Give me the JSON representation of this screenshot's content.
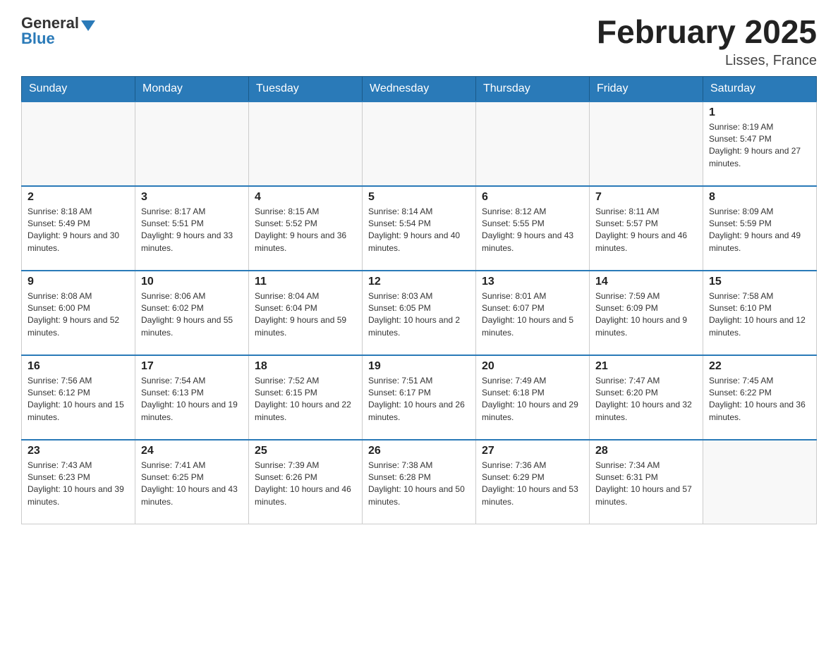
{
  "logo": {
    "general": "General",
    "blue": "Blue",
    "triangle": "▶"
  },
  "title": "February 2025",
  "location": "Lisses, France",
  "weekdays": [
    "Sunday",
    "Monday",
    "Tuesday",
    "Wednesday",
    "Thursday",
    "Friday",
    "Saturday"
  ],
  "weeks": [
    [
      {
        "day": "",
        "info": ""
      },
      {
        "day": "",
        "info": ""
      },
      {
        "day": "",
        "info": ""
      },
      {
        "day": "",
        "info": ""
      },
      {
        "day": "",
        "info": ""
      },
      {
        "day": "",
        "info": ""
      },
      {
        "day": "1",
        "info": "Sunrise: 8:19 AM\nSunset: 5:47 PM\nDaylight: 9 hours and 27 minutes."
      }
    ],
    [
      {
        "day": "2",
        "info": "Sunrise: 8:18 AM\nSunset: 5:49 PM\nDaylight: 9 hours and 30 minutes."
      },
      {
        "day": "3",
        "info": "Sunrise: 8:17 AM\nSunset: 5:51 PM\nDaylight: 9 hours and 33 minutes."
      },
      {
        "day": "4",
        "info": "Sunrise: 8:15 AM\nSunset: 5:52 PM\nDaylight: 9 hours and 36 minutes."
      },
      {
        "day": "5",
        "info": "Sunrise: 8:14 AM\nSunset: 5:54 PM\nDaylight: 9 hours and 40 minutes."
      },
      {
        "day": "6",
        "info": "Sunrise: 8:12 AM\nSunset: 5:55 PM\nDaylight: 9 hours and 43 minutes."
      },
      {
        "day": "7",
        "info": "Sunrise: 8:11 AM\nSunset: 5:57 PM\nDaylight: 9 hours and 46 minutes."
      },
      {
        "day": "8",
        "info": "Sunrise: 8:09 AM\nSunset: 5:59 PM\nDaylight: 9 hours and 49 minutes."
      }
    ],
    [
      {
        "day": "9",
        "info": "Sunrise: 8:08 AM\nSunset: 6:00 PM\nDaylight: 9 hours and 52 minutes."
      },
      {
        "day": "10",
        "info": "Sunrise: 8:06 AM\nSunset: 6:02 PM\nDaylight: 9 hours and 55 minutes."
      },
      {
        "day": "11",
        "info": "Sunrise: 8:04 AM\nSunset: 6:04 PM\nDaylight: 9 hours and 59 minutes."
      },
      {
        "day": "12",
        "info": "Sunrise: 8:03 AM\nSunset: 6:05 PM\nDaylight: 10 hours and 2 minutes."
      },
      {
        "day": "13",
        "info": "Sunrise: 8:01 AM\nSunset: 6:07 PM\nDaylight: 10 hours and 5 minutes."
      },
      {
        "day": "14",
        "info": "Sunrise: 7:59 AM\nSunset: 6:09 PM\nDaylight: 10 hours and 9 minutes."
      },
      {
        "day": "15",
        "info": "Sunrise: 7:58 AM\nSunset: 6:10 PM\nDaylight: 10 hours and 12 minutes."
      }
    ],
    [
      {
        "day": "16",
        "info": "Sunrise: 7:56 AM\nSunset: 6:12 PM\nDaylight: 10 hours and 15 minutes."
      },
      {
        "day": "17",
        "info": "Sunrise: 7:54 AM\nSunset: 6:13 PM\nDaylight: 10 hours and 19 minutes."
      },
      {
        "day": "18",
        "info": "Sunrise: 7:52 AM\nSunset: 6:15 PM\nDaylight: 10 hours and 22 minutes."
      },
      {
        "day": "19",
        "info": "Sunrise: 7:51 AM\nSunset: 6:17 PM\nDaylight: 10 hours and 26 minutes."
      },
      {
        "day": "20",
        "info": "Sunrise: 7:49 AM\nSunset: 6:18 PM\nDaylight: 10 hours and 29 minutes."
      },
      {
        "day": "21",
        "info": "Sunrise: 7:47 AM\nSunset: 6:20 PM\nDaylight: 10 hours and 32 minutes."
      },
      {
        "day": "22",
        "info": "Sunrise: 7:45 AM\nSunset: 6:22 PM\nDaylight: 10 hours and 36 minutes."
      }
    ],
    [
      {
        "day": "23",
        "info": "Sunrise: 7:43 AM\nSunset: 6:23 PM\nDaylight: 10 hours and 39 minutes."
      },
      {
        "day": "24",
        "info": "Sunrise: 7:41 AM\nSunset: 6:25 PM\nDaylight: 10 hours and 43 minutes."
      },
      {
        "day": "25",
        "info": "Sunrise: 7:39 AM\nSunset: 6:26 PM\nDaylight: 10 hours and 46 minutes."
      },
      {
        "day": "26",
        "info": "Sunrise: 7:38 AM\nSunset: 6:28 PM\nDaylight: 10 hours and 50 minutes."
      },
      {
        "day": "27",
        "info": "Sunrise: 7:36 AM\nSunset: 6:29 PM\nDaylight: 10 hours and 53 minutes."
      },
      {
        "day": "28",
        "info": "Sunrise: 7:34 AM\nSunset: 6:31 PM\nDaylight: 10 hours and 57 minutes."
      },
      {
        "day": "",
        "info": ""
      }
    ]
  ]
}
